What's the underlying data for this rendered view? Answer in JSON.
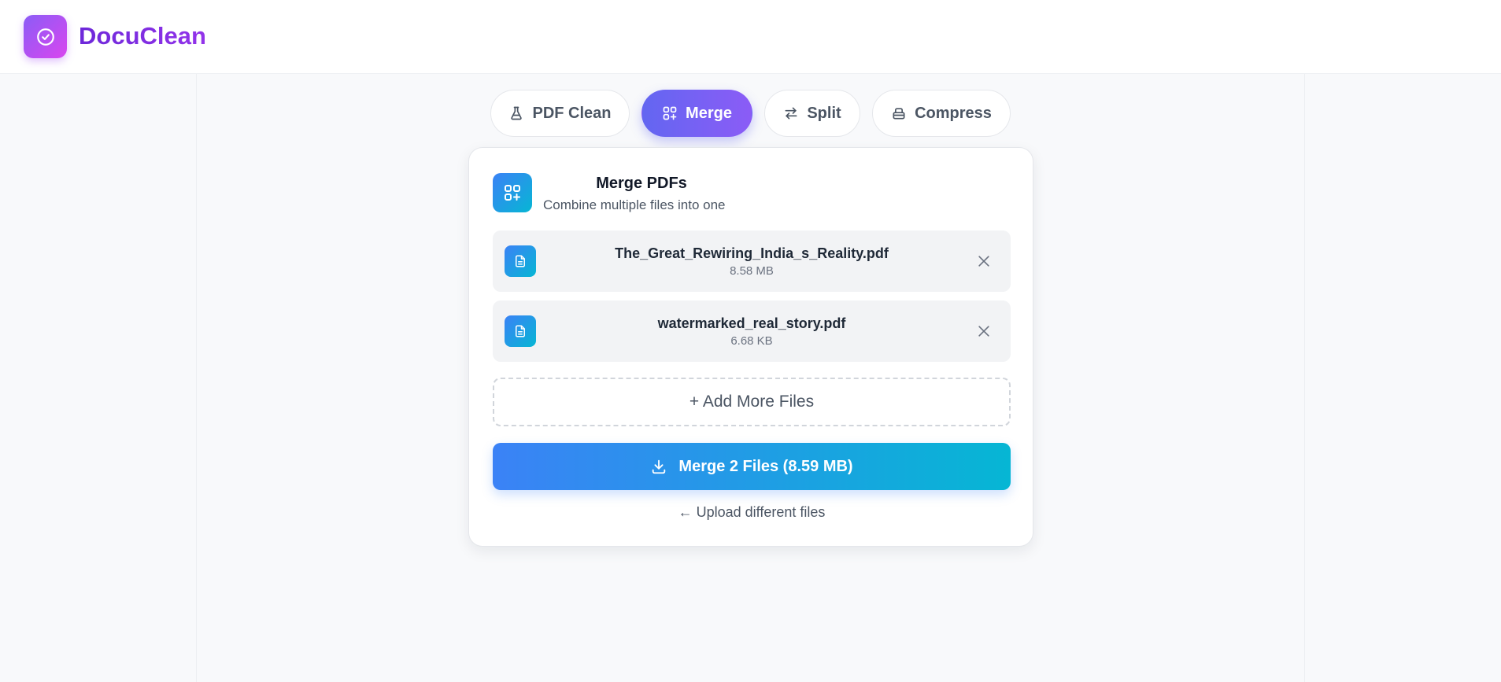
{
  "app": {
    "brand": "DocuClean",
    "logo_icon": "check-circle-icon",
    "accent": "#8b5cf6"
  },
  "tabs": [
    {
      "label": "PDF Clean",
      "icon": "flask-icon",
      "active": false
    },
    {
      "label": "Merge",
      "icon": "merge-grid-icon",
      "active": true
    },
    {
      "label": "Split",
      "icon": "arrows-swap-icon",
      "active": false
    },
    {
      "label": "Compress",
      "icon": "compress-icon",
      "active": false
    }
  ],
  "card": {
    "title": "Merge PDFs",
    "subtitle": "Combine multiple files into one",
    "files": [
      {
        "name": "The_Great_Rewiring_India_s_Reality.pdf",
        "size": "8.58 MB"
      },
      {
        "name": "watermarked_real_story.pdf",
        "size": "6.68 KB"
      }
    ],
    "add_more_label": "+ Add More Files",
    "merge_label": "Merge 2 Files (8.59 MB)",
    "back_label": "← Upload different files"
  },
  "colors": {
    "primary_gradient_start": "#3b82f6",
    "primary_gradient_end": "#06b6d4",
    "tab_active_start": "#6366f1",
    "tab_active_end": "#8b5cf6"
  }
}
